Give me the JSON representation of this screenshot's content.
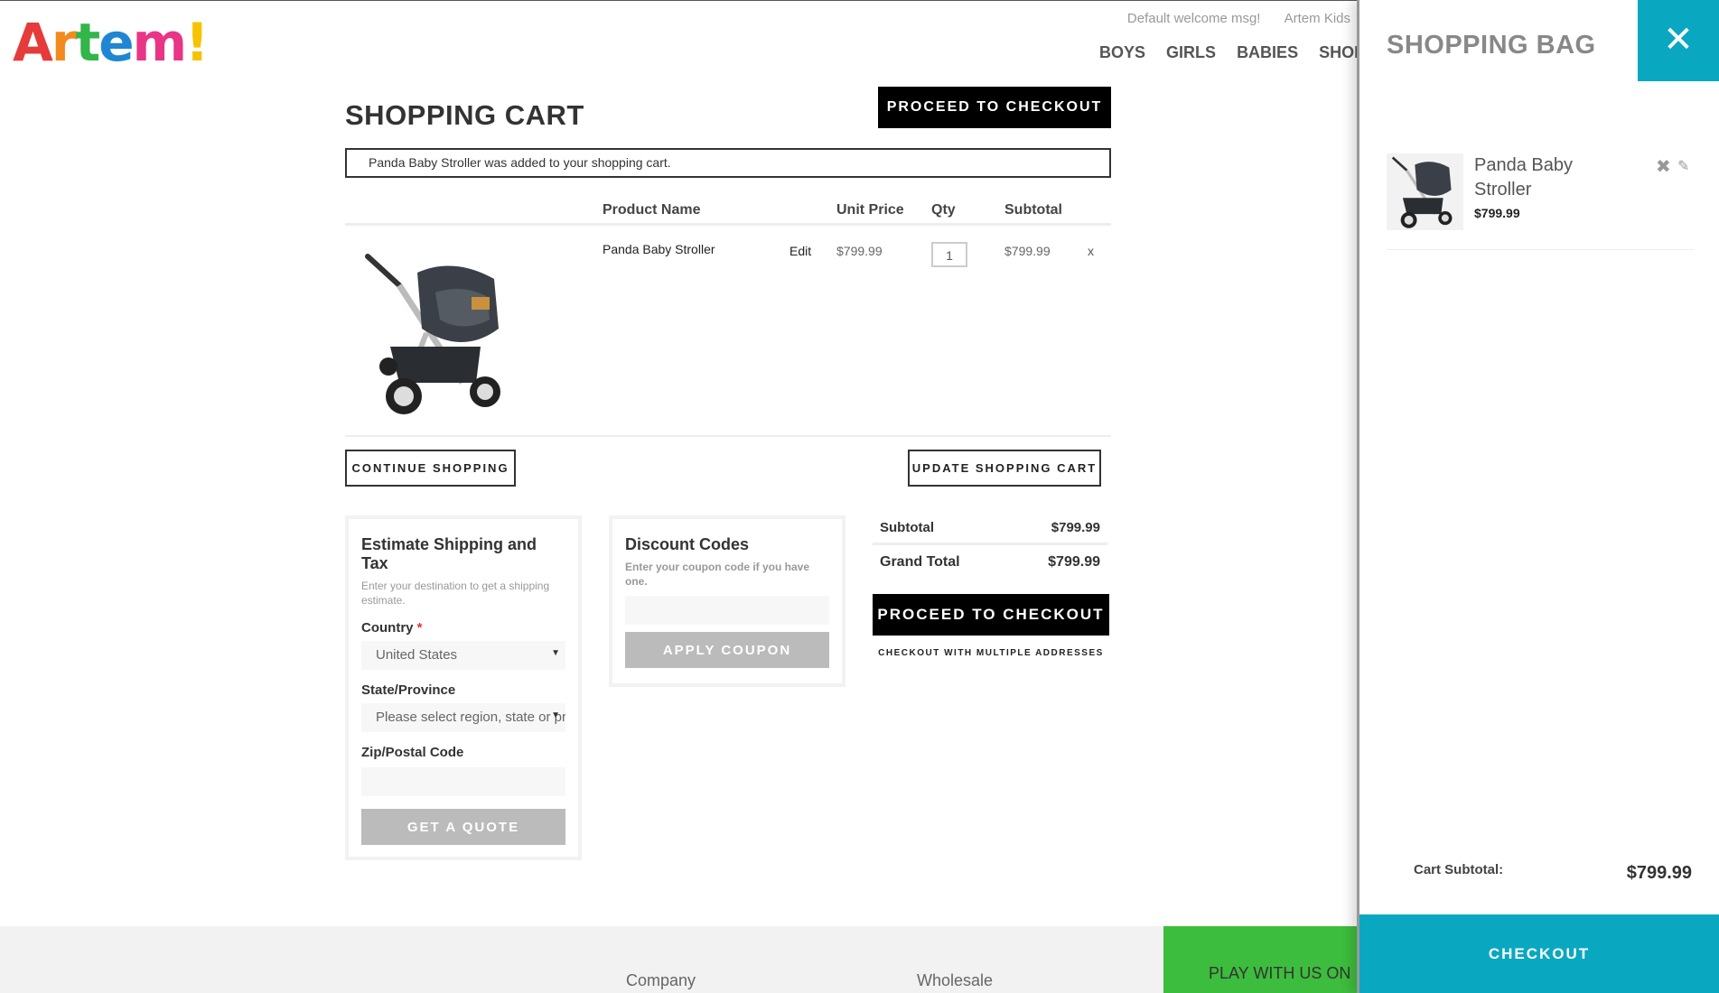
{
  "brand": {
    "logo_letters": [
      {
        "ch": "A",
        "color": "#e63b3b"
      },
      {
        "ch": "r",
        "color": "#f28a1e"
      },
      {
        "ch": "t",
        "color": "#32b54a"
      },
      {
        "ch": "e",
        "color": "#1f86d3"
      },
      {
        "ch": "m",
        "color": "#e83586"
      },
      {
        "ch": "!",
        "color": "#f5c400"
      }
    ]
  },
  "header": {
    "welcome": "Default welcome msg!",
    "store_link": "Artem Kids",
    "nav": [
      "BOYS",
      "GIRLS",
      "BABIES",
      "SHOES"
    ]
  },
  "cart": {
    "title": "SHOPPING CART",
    "proceed_label": "PROCEED TO CHECKOUT",
    "added_message": "Panda Baby Stroller was added to your shopping cart.",
    "columns": {
      "product_name": "Product Name",
      "unit_price": "Unit Price",
      "qty": "Qty",
      "subtotal": "Subtotal"
    },
    "item": {
      "name": "Panda Baby Stroller",
      "edit_label": "Edit",
      "unit_price": "$799.99",
      "qty": "1",
      "subtotal": "$799.99",
      "remove_label": "x"
    },
    "continue_label": "CONTINUE SHOPPING",
    "update_label": "UPDATE SHOPPING CART"
  },
  "shipping": {
    "title": "Estimate Shipping and Tax",
    "hint": "Enter your destination to get a shipping estimate.",
    "country_label": "Country",
    "country_required": "*",
    "country_value": "United States",
    "state_label": "State/Province",
    "state_value": "Please select region, state or province",
    "zip_label": "Zip/Postal Code",
    "quote_label": "GET A QUOTE"
  },
  "discount": {
    "title": "Discount Codes",
    "hint": "Enter your coupon code if you have one.",
    "apply_label": "APPLY COUPON"
  },
  "totals": {
    "subtotal_label": "Subtotal",
    "subtotal_value": "$799.99",
    "grand_label": "Grand Total",
    "grand_value": "$799.99",
    "proceed_label": "PROCEED TO CHECKOUT",
    "multi_label": "CHECKOUT WITH MULTIPLE ADDRESSES"
  },
  "footer": {
    "col1": "Company",
    "col2": "Wholesale",
    "play_label": "PLAY WITH US ON"
  },
  "bag": {
    "title": "SHOPPING BAG",
    "close_icon": "close-icon",
    "item_name": "Panda Baby Stroller",
    "item_price": "$799.99",
    "subtotal_label": "Cart Subtotal:",
    "subtotal_value": "$799.99",
    "checkout_label": "CHECKOUT"
  },
  "colors": {
    "accent": "#0aa8c0",
    "play_green": "#3dbd3d"
  }
}
